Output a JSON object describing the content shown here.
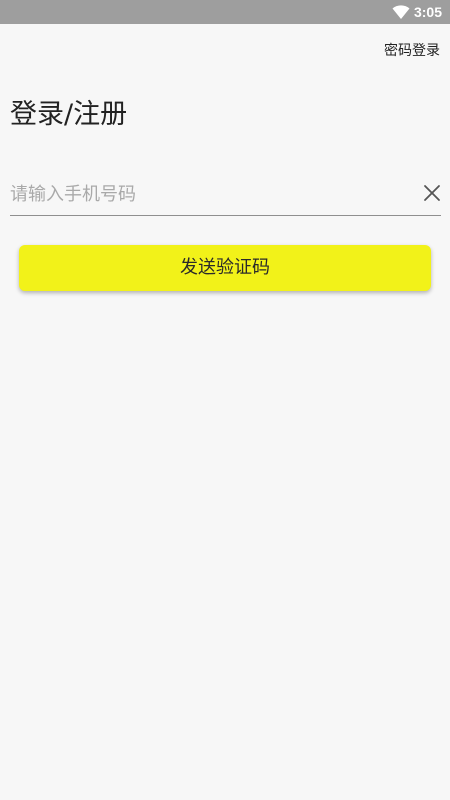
{
  "status_bar": {
    "time": "3:05",
    "wifi_icon": "wifi-icon",
    "background": "#9e9e9e"
  },
  "header": {
    "password_login": "密码登录"
  },
  "main": {
    "title": "登录/注册",
    "phone_input": {
      "value": "",
      "placeholder": "请输入手机号码",
      "clear_icon": "close-icon"
    },
    "send_code_button": "发送验证码"
  },
  "colors": {
    "accent": "#f2f219",
    "background": "#f7f7f7",
    "text": "#222222",
    "placeholder": "#a9a9a9"
  }
}
